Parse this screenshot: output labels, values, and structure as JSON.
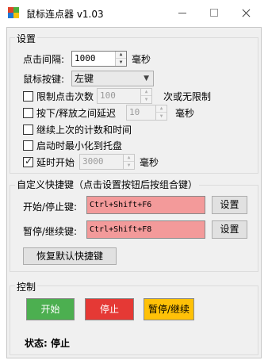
{
  "window": {
    "title": "鼠标连点器 v1.03"
  },
  "settings": {
    "group_title": "设置",
    "interval_label": "点击间隔:",
    "interval_value": "1000",
    "interval_unit": "毫秒",
    "button_label": "鼠标按键:",
    "button_value": "左键",
    "limit_clicks_label": "限制点击次数",
    "limit_clicks_value": "100",
    "limit_clicks_suffix": "次或无限制",
    "press_release_label": "按下/释放之间延迟",
    "press_release_value": "10",
    "press_release_unit": "毫秒",
    "continue_label": "继续上次的计数和时间",
    "minimize_label": "启动时最小化到托盘",
    "delay_start_label": "延时开始",
    "delay_start_value": "3000",
    "delay_start_unit": "毫秒",
    "checkboxes": {
      "limit_clicks": false,
      "press_release": false,
      "continue": false,
      "minimize": false,
      "delay_start": true
    }
  },
  "hotkeys": {
    "group_title": "自定义快捷键（点击设置按钮后按组合键）",
    "start_stop_label": "开始/停止键:",
    "start_stop_value": "Ctrl+Shift+F6",
    "pause_resume_label": "暂停/继续键:",
    "pause_resume_value": "Ctrl+Shift+F8",
    "set_label": "设置",
    "reset_label": "恢复默认快捷键"
  },
  "control": {
    "group_title": "控制",
    "start_label": "开始",
    "stop_label": "停止",
    "pause_label": "暂停/继续",
    "status_text": "状态: 停止"
  },
  "colors": {
    "start": "#4caf50",
    "stop": "#e53935",
    "pause": "#ffc107",
    "hotkey_field": "#f39a9a"
  }
}
